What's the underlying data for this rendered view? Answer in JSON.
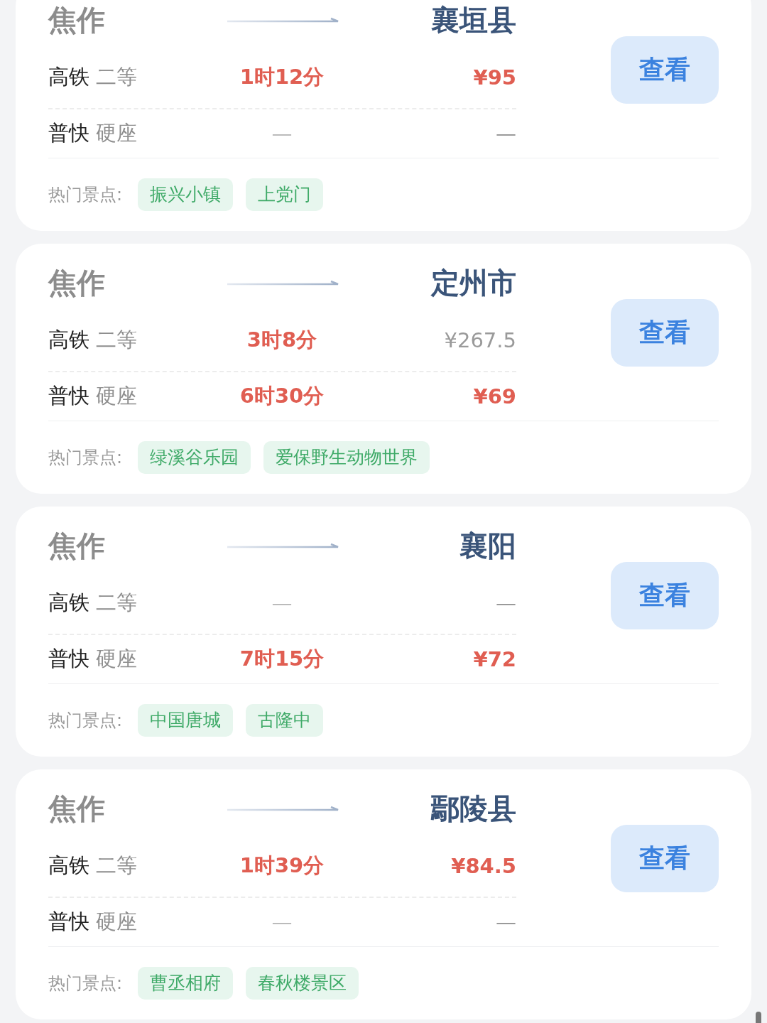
{
  "routes": [
    {
      "origin": "焦作",
      "destination": "襄垣县",
      "trains": [
        {
          "train": "高铁",
          "seat": "二等",
          "duration": "1时12分",
          "price": "¥95",
          "highlight": true
        },
        {
          "train": "普快",
          "seat": "硬座",
          "duration": "—",
          "price": "—",
          "highlight": false
        }
      ],
      "button": "查看",
      "attractions_label": "热门景点:",
      "attractions": [
        "振兴小镇",
        "上党门"
      ]
    },
    {
      "origin": "焦作",
      "destination": "定州市",
      "trains": [
        {
          "train": "高铁",
          "seat": "二等",
          "duration": "3时8分",
          "price": "¥267.5",
          "highlight": false
        },
        {
          "train": "普快",
          "seat": "硬座",
          "duration": "6时30分",
          "price": "¥69",
          "highlight": true
        }
      ],
      "button": "查看",
      "attractions_label": "热门景点:",
      "attractions": [
        "绿溪谷乐园",
        "爱保野生动物世界"
      ]
    },
    {
      "origin": "焦作",
      "destination": "襄阳",
      "trains": [
        {
          "train": "高铁",
          "seat": "二等",
          "duration": "—",
          "price": "—",
          "highlight": false
        },
        {
          "train": "普快",
          "seat": "硬座",
          "duration": "7时15分",
          "price": "¥72",
          "highlight": true
        }
      ],
      "button": "查看",
      "attractions_label": "热门景点:",
      "attractions": [
        "中国唐城",
        "古隆中"
      ]
    },
    {
      "origin": "焦作",
      "destination": "鄢陵县",
      "trains": [
        {
          "train": "高铁",
          "seat": "二等",
          "duration": "1时39分",
          "price": "¥84.5",
          "highlight": true
        },
        {
          "train": "普快",
          "seat": "硬座",
          "duration": "—",
          "price": "—",
          "highlight": false
        }
      ],
      "button": "查看",
      "attractions_label": "热门景点:",
      "attractions": [
        "曹丞相府",
        "春秋楼景区"
      ]
    }
  ]
}
